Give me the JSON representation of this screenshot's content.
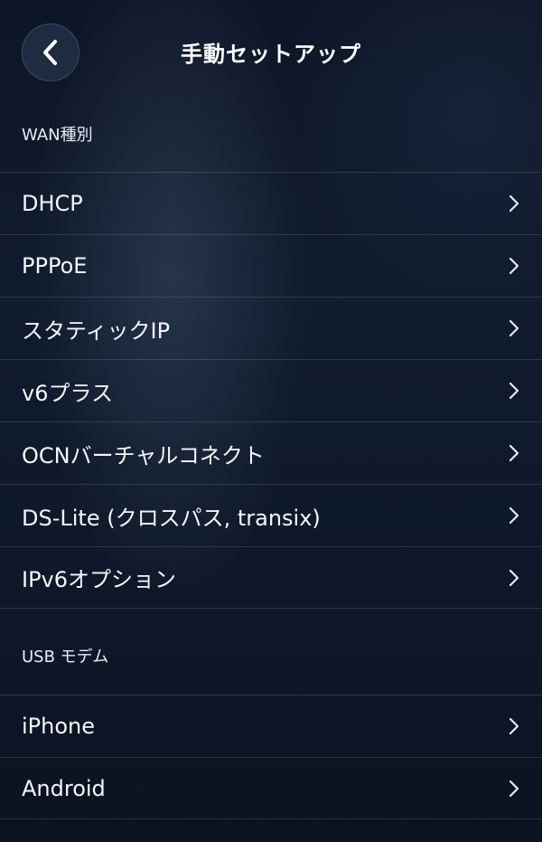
{
  "header": {
    "title": "手動セットアップ",
    "back_icon": "chevron-left-icon"
  },
  "wan_section": {
    "label": "WAN種別",
    "items": [
      {
        "label": "DHCP"
      },
      {
        "label": "PPPoE"
      },
      {
        "label": "スタティックIP"
      },
      {
        "label": "v6プラス"
      },
      {
        "label": "OCNバーチャルコネクト"
      },
      {
        "label": "DS-Lite (クロスパス, transix)"
      },
      {
        "label": "IPv6オプション"
      }
    ]
  },
  "usb_section": {
    "label": "USB モデム",
    "items": [
      {
        "label": "iPhone"
      },
      {
        "label": "Android"
      }
    ]
  },
  "colors": {
    "background": "#0f1a2c",
    "text": "#ffffff",
    "divider": "rgba(255,255,255,0.13)",
    "back_button_bg": "#1e2b40"
  }
}
